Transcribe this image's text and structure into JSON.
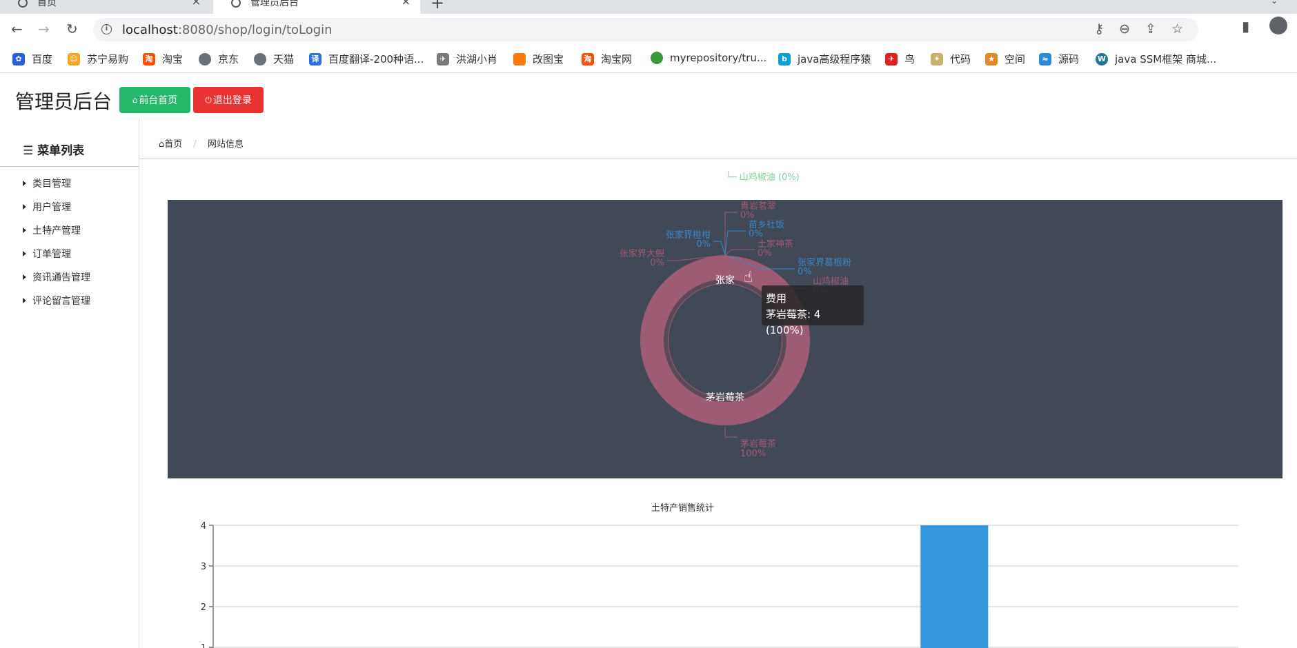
{
  "browser": {
    "tabs": [
      {
        "title": "首页",
        "active": false
      },
      {
        "title": "管理员后台",
        "active": true
      }
    ],
    "url_host": "localhost",
    "url_rest": ":8080/shop/login/toLogin",
    "bookmarks": [
      {
        "label": "百度",
        "icon": "paw-icon",
        "color": "#2b5de0"
      },
      {
        "label": "苏宁易购",
        "icon": "lion-icon",
        "color": "#f5a623"
      },
      {
        "label": "淘宝",
        "icon": "taobao-icon",
        "color": "#ff5000"
      },
      {
        "label": "京东",
        "icon": "globe-icon",
        "color": "#6b7178"
      },
      {
        "label": "天猫",
        "icon": "globe-icon",
        "color": "#6b7178"
      },
      {
        "label": "百度翻译-200种语...",
        "icon": "translate-icon",
        "color": "#2b6fe0"
      },
      {
        "label": "洪湖小肖",
        "icon": "bird-icon",
        "color": "#7a7a7a"
      },
      {
        "label": "改图宝",
        "icon": "square-icon",
        "color": "#ff7a00"
      },
      {
        "label": "淘宝网",
        "icon": "taobao-icon",
        "color": "#ff5000"
      },
      {
        "label": "myrepository/tru...",
        "icon": "repo-icon",
        "color": "#3a9a3a"
      },
      {
        "label": "java高级程序猿",
        "icon": "bilibili-icon",
        "color": "#00a1d6"
      },
      {
        "label": "鸟",
        "icon": "bird-icon",
        "color": "#e02020"
      },
      {
        "label": "代码",
        "icon": "leaf-icon",
        "color": "#c9b06b"
      },
      {
        "label": "空间",
        "icon": "star-icon",
        "color": "#e08a2a"
      },
      {
        "label": "源码",
        "icon": "fish-icon",
        "color": "#2a8ae0"
      },
      {
        "label": "java SSM框架 商城...",
        "icon": "wordpress-icon",
        "color": "#21759b"
      }
    ]
  },
  "header": {
    "title": "管理员后台",
    "home_button": "前台首页",
    "logout_button": "退出登录"
  },
  "sidebar": {
    "heading": "菜单列表",
    "items": [
      "类目管理",
      "用户管理",
      "土特产管理",
      "订单管理",
      "资讯通告管理",
      "评论留言管理"
    ]
  },
  "breadcrumb": {
    "home": "首页",
    "current": "网站信息"
  },
  "faded_legend": "山鸡椒油 (0%)",
  "tooltip": {
    "series": "费用",
    "entry": "茅岩莓茶: 4 (100%)"
  },
  "colors": {
    "panel_bg": "#414856",
    "donut": "#9e5b74",
    "bar": "#3398db",
    "label_pink": "#9e5b74",
    "label_blue": "#3b87c8"
  },
  "chart_data": [
    {
      "type": "pie",
      "variant": "donut",
      "series_name": "费用",
      "slices": [
        {
          "name": "茅岩莓茶",
          "value": 4,
          "percent": "100%"
        },
        {
          "name": "青岩茗翠",
          "value": 0,
          "percent": "0%"
        },
        {
          "name": "苗乡社饭",
          "value": 0,
          "percent": "0%"
        },
        {
          "name": "土家神茶",
          "value": 0,
          "percent": "0%"
        },
        {
          "name": "张家界葛根粉",
          "value": 0,
          "percent": "0%"
        },
        {
          "name": "山鸡椒油",
          "value": 0,
          "percent": "0%"
        },
        {
          "name": "张家界椪柑",
          "value": 0,
          "percent": "0%"
        },
        {
          "name": "张家界大鲵",
          "value": 0,
          "percent": "0%"
        }
      ],
      "inner_label": "茅岩莓茶"
    },
    {
      "type": "bar",
      "title": "土特产销售统计",
      "yticks": [
        "4",
        "3",
        "2",
        "1"
      ],
      "ylim": [
        0,
        4
      ],
      "grid": true,
      "bars": [
        {
          "position": 0.69,
          "value": 4
        }
      ]
    }
  ]
}
